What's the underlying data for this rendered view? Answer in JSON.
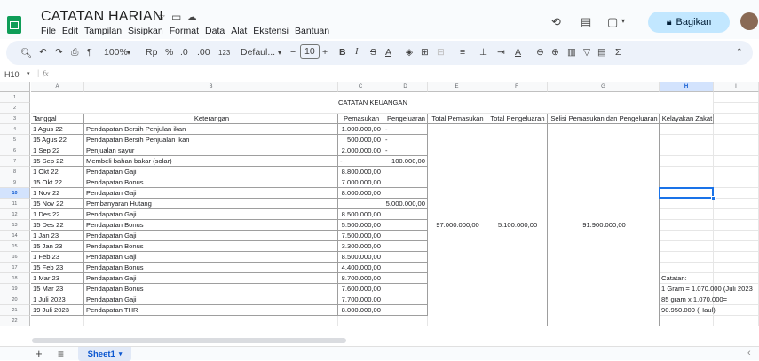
{
  "doc": {
    "title": "CATATAN HARIAN"
  },
  "menu": [
    "File",
    "Edit",
    "Tampilan",
    "Sisipkan",
    "Format",
    "Data",
    "Alat",
    "Ekstensi",
    "Bantuan"
  ],
  "share_label": "Bagikan",
  "toolbar": {
    "zoom": "100%",
    "currency": "Rp",
    "percent": "%",
    "dec_less": ".0",
    "dec_more": ".00",
    "numfmt": "123",
    "font": "Defaul...",
    "font_size": "10"
  },
  "formula": {
    "cellref": "H10",
    "fx": "fx",
    "value": ""
  },
  "columns": [
    "A",
    "B",
    "C",
    "D",
    "E",
    "F",
    "G",
    "H",
    "I"
  ],
  "selected_cell": "H10",
  "sheet_title": "CATATAN KEUANGAN",
  "headers": [
    "Tanggal",
    "Keterangan",
    "Pemasukan",
    "Pengeluaran",
    "Total Pemasukan",
    "Total Pengeluaran",
    "Selisi Pemasukan dan Pengeluaran",
    "Kelayakan Zakat"
  ],
  "rows": [
    {
      "tanggal": "1 Agus 22",
      "ket": "Pendapatan Bersih Penjulan ikan",
      "masuk": "1.000.000,00",
      "keluar": "-"
    },
    {
      "tanggal": "15 Agus 22",
      "ket": "Pendapatan Bersih Penjualan ikan",
      "masuk": "500.000,00",
      "keluar": "-"
    },
    {
      "tanggal": "1 Sep 22",
      "ket": "Penjualan sayur",
      "masuk": "2.000.000,00",
      "keluar": "-"
    },
    {
      "tanggal": "15 Sep 22",
      "ket": "Membeli bahan bakar (solar)",
      "masuk": "-",
      "keluar": "100.000,00"
    },
    {
      "tanggal": "1 Okt 22",
      "ket": "Pendapatan Gaji",
      "masuk": "8.800.000,00",
      "keluar": ""
    },
    {
      "tanggal": "15 Okt 22",
      "ket": "Pendapatan Bonus",
      "masuk": "7.000.000,00",
      "keluar": ""
    },
    {
      "tanggal": "1 Nov 22",
      "ket": "Pendapatan Gaji",
      "masuk": "8.000.000,00",
      "keluar": ""
    },
    {
      "tanggal": "15 Nov 22",
      "ket": "Pembanyaran Hutang",
      "masuk": "",
      "keluar": "5.000.000,00"
    },
    {
      "tanggal": "1 Des 22",
      "ket": "Pendapatan Gaji",
      "masuk": "8.500.000,00",
      "keluar": ""
    },
    {
      "tanggal": "15 Des 22",
      "ket": "Pendapatan Bonus",
      "masuk": "5.500.000,00",
      "keluar": ""
    },
    {
      "tanggal": "1 Jan 23",
      "ket": "Pendapatan Gaji",
      "masuk": "7.500.000,00",
      "keluar": ""
    },
    {
      "tanggal": "15 Jan 23",
      "ket": "Pendapatan Bonus",
      "masuk": "3.300.000,00",
      "keluar": ""
    },
    {
      "tanggal": "1 Feb 23",
      "ket": "Pendapatan Gaji",
      "masuk": "8.500.000,00",
      "keluar": ""
    },
    {
      "tanggal": "15 Feb 23",
      "ket": "Pendapatan Bonus",
      "masuk": "4.400.000,00",
      "keluar": ""
    },
    {
      "tanggal": "1 Mar 23",
      "ket": "Pendapatan Gaji",
      "masuk": "8.700.000,00",
      "keluar": ""
    },
    {
      "tanggal": "15 Mar 23",
      "ket": "Pendapatan Bonus",
      "masuk": "7.600.000,00",
      "keluar": ""
    },
    {
      "tanggal": "1 Juli 2023",
      "ket": "Pendapatan Gaji",
      "masuk": "7.700.000,00",
      "keluar": ""
    },
    {
      "tanggal": "19 Juli 2023",
      "ket": "Pendapatan THR",
      "masuk": "8.000.000,00",
      "keluar": ""
    }
  ],
  "totals": {
    "pemasukan": "97.000.000,00",
    "pengeluaran": "5.100.000,00",
    "selisih": "91.900.000,00"
  },
  "notes": [
    "Catatan:",
    "1 Gram = 1.070.000 (Juli 2023",
    "85 gram x 1.070.000=",
    "90.950.000 (Haul)"
  ],
  "sheet_tab": "Sheet1",
  "colors": {
    "accent": "#1a73e8",
    "share_bg": "#c2e7ff",
    "logo": "#0f9d58"
  }
}
